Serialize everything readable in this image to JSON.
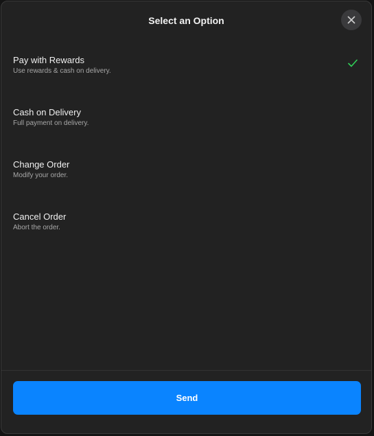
{
  "dialog": {
    "title": "Select an Option",
    "close_icon": "close-icon"
  },
  "options": [
    {
      "label": "Pay with Rewards",
      "description": "Use rewards & cash on delivery.",
      "selected": true
    },
    {
      "label": "Cash on Delivery",
      "description": "Full payment on delivery.",
      "selected": false
    },
    {
      "label": "Change Order",
      "description": "Modify your order.",
      "selected": false
    },
    {
      "label": "Cancel Order",
      "description": "Abort the order.",
      "selected": false
    }
  ],
  "footer": {
    "send_label": "Send"
  },
  "colors": {
    "background": "#222222",
    "accent": "#0a84ff",
    "check": "#30d158"
  }
}
